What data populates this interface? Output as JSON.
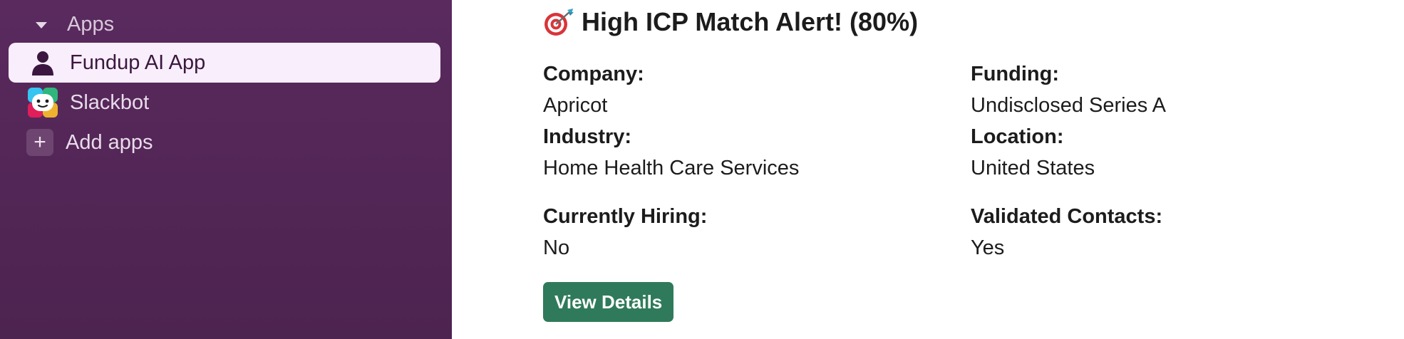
{
  "sidebar": {
    "section_label": "Apps",
    "apps": [
      {
        "label": "Fundup AI App",
        "icon": "person-icon",
        "selected": true
      },
      {
        "label": "Slackbot",
        "icon": "slackbot-icon",
        "selected": false
      }
    ],
    "add_apps_label": "Add apps",
    "add_icon_glyph": "+"
  },
  "message": {
    "title": "High ICP Match Alert! (80%)",
    "title_icon": "target-dart-icon",
    "fields": {
      "company_label": "Company:",
      "company_value": "Apricot",
      "funding_label": "Funding:",
      "funding_value": "Undisclosed Series A",
      "industry_label": "Industry:",
      "industry_value": "Home Health Care Services",
      "location_label": "Location:",
      "location_value": "United States",
      "hiring_label": "Currently Hiring:",
      "hiring_value": "No",
      "contacts_label": "Validated Contacts:",
      "contacts_value": "Yes"
    },
    "button_label": "View Details"
  },
  "colors": {
    "sidebar_bg": "#522656",
    "selected_item_bg": "#f9eefb",
    "button_bg": "#2f7a5a"
  }
}
